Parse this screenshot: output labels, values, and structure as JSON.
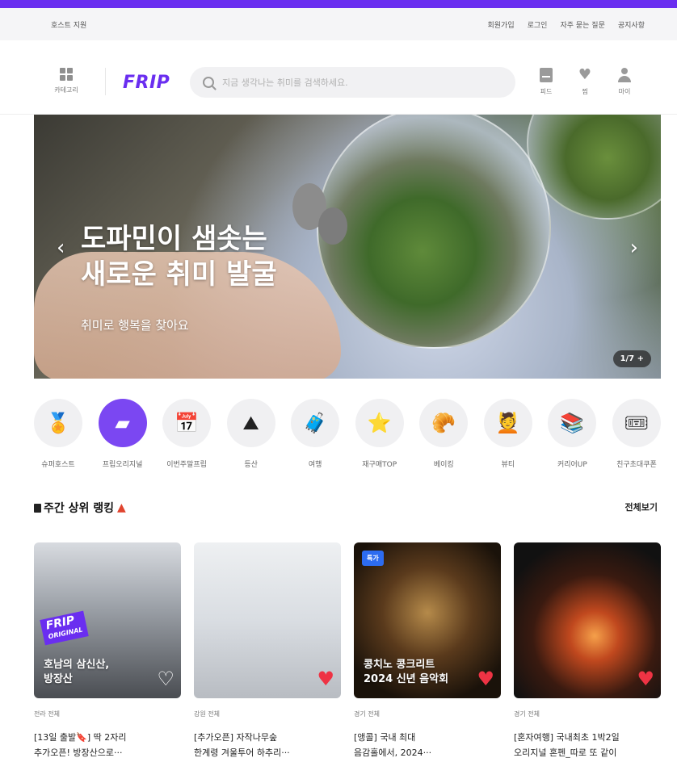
{
  "util": {
    "host_support": "호스트 지원",
    "links": [
      "회원가입",
      "로그인",
      "자주 묻는 질문",
      "공지사항"
    ]
  },
  "header": {
    "category_label": "카테고리",
    "logo": "FRIP",
    "search_placeholder": "지금 생각나는 취미를 검색하세요.",
    "feed_label": "피드",
    "wish_label": "찜",
    "my_label": "마이"
  },
  "banner": {
    "title": "도파민이 샘솟는\n새로운 취미 발굴",
    "subtitle": "취미로 행복을 찾아요",
    "counter": "1/7 +"
  },
  "categories": [
    {
      "label": "슈퍼호스트",
      "icon": "medal-icon",
      "glyph": "🏅"
    },
    {
      "label": "프립오리지널",
      "icon": "frip-original-icon",
      "glyph": "▰"
    },
    {
      "label": "이번주말프립",
      "icon": "calendar-sun-icon",
      "glyph": "📅"
    },
    {
      "label": "등산",
      "icon": "mountain-icon",
      "glyph": "⛰"
    },
    {
      "label": "여행",
      "icon": "suitcase-icon",
      "glyph": "🧳"
    },
    {
      "label": "재구매TOP",
      "icon": "stars-icon",
      "glyph": "⭐"
    },
    {
      "label": "베이킹",
      "icon": "bread-icon",
      "glyph": "🥐"
    },
    {
      "label": "뷰티",
      "icon": "face-mask-icon",
      "glyph": "💆"
    },
    {
      "label": "커리어UP",
      "icon": "books-icon",
      "glyph": "📚"
    },
    {
      "label": "친구초대쿠폰",
      "icon": "coupon-icon",
      "glyph": "🎟"
    }
  ],
  "ranking": {
    "title": "주간 상위 랭킹",
    "see_all": "전체보기"
  },
  "cards": [
    {
      "region": "전라 전체",
      "title": "[13일 출발🔖] 딱 2자리\n추가오픈! 방장산으로···",
      "overlay": "호남의 삼신산,\n방장산",
      "liked": false,
      "badge": "FRIP",
      "badge_sub": "ORIGINAL"
    },
    {
      "region": "강원 전체",
      "title": "[추가오픈] 자작나무숲\n한계령 겨울투어 하추리···",
      "overlay": "",
      "liked": true
    },
    {
      "region": "경기 전체",
      "title": "[앵콜] 국내 최대\n음감홀에서, 2024···",
      "overlay": "콩치노 콩크리트\n2024 신년 음악회",
      "liked": true,
      "tag": "특가"
    },
    {
      "region": "경기 전체",
      "title": "[혼자여행] 국내최초 1박2일\n오리지널 혼펜_따로 또 같이",
      "overlay": "",
      "liked": true
    }
  ],
  "colors": {
    "accent": "#6a2ef0",
    "heart_liked": "#ee3344"
  }
}
